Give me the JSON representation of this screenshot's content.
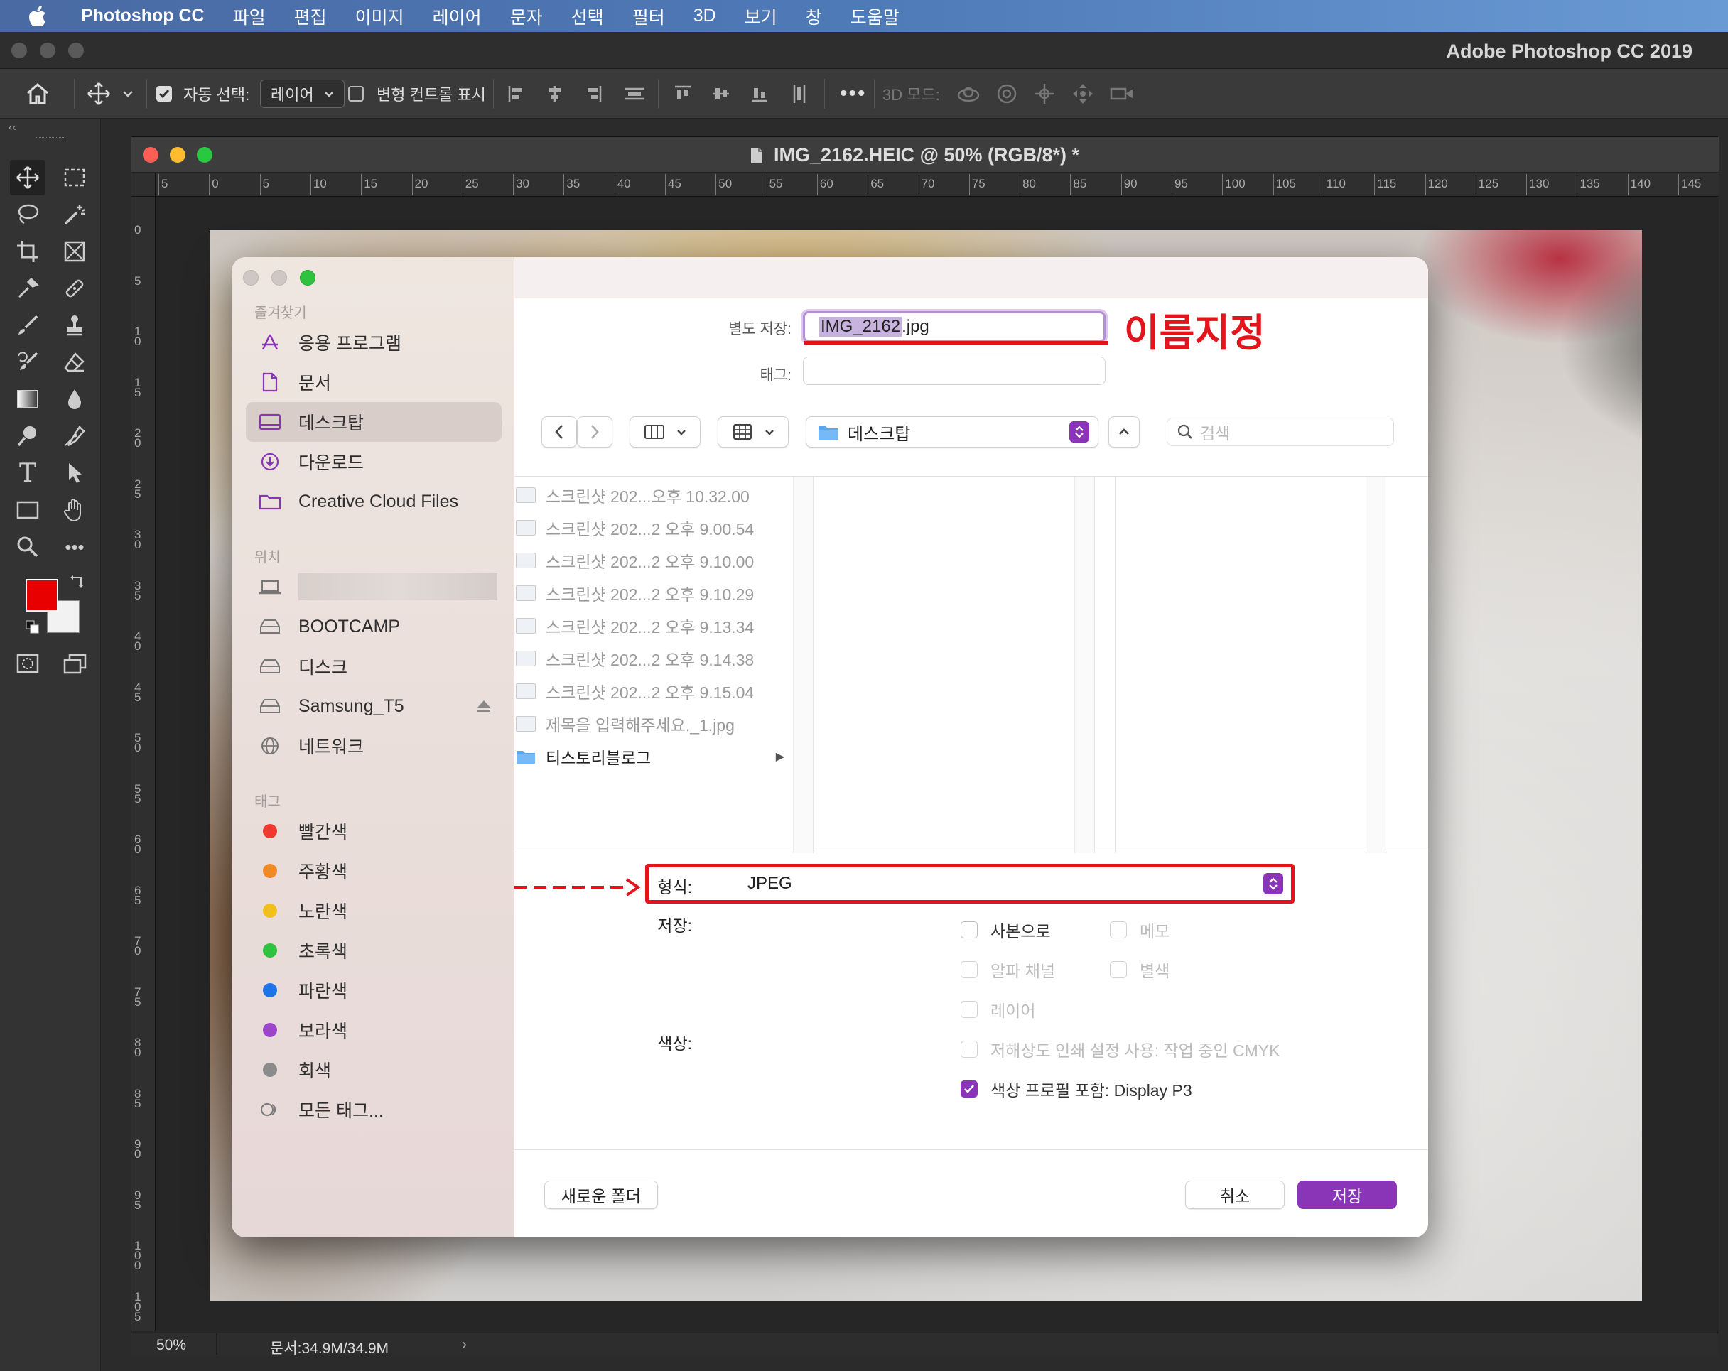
{
  "menubar": {
    "app_name": "Photoshop CC",
    "items": [
      "파일",
      "편집",
      "이미지",
      "레이어",
      "문자",
      "선택",
      "필터",
      "3D",
      "보기",
      "창",
      "도움말"
    ]
  },
  "window_title": "Adobe Photoshop CC 2019",
  "options_bar": {
    "auto_select_label": "자동 선택:",
    "auto_select_value": "레이어",
    "transform_label": "변형 컨트롤 표시",
    "mode_3d_label": "3D 모드:"
  },
  "colors": {
    "foreground": "#e80000",
    "background": "#f2f2f2",
    "accent": "#8a35b7",
    "annotation": "#e3141b"
  },
  "document": {
    "title": "IMG_2162.HEIC @ 50% (RGB/8*) *",
    "zoom": "50%",
    "doc_size": "문서:34.9M/34.9M",
    "ruler_h": [
      "5",
      "0",
      "5",
      "10",
      "15",
      "20",
      "25",
      "30",
      "35",
      "40",
      "45",
      "50",
      "55",
      "60",
      "65",
      "70",
      "75",
      "80",
      "85",
      "90",
      "95",
      "100",
      "105",
      "110",
      "115",
      "120",
      "125",
      "130",
      "135",
      "140",
      "145"
    ],
    "ruler_v": [
      "0",
      "5",
      "1 0",
      "1 5",
      "2 0",
      "2 5",
      "3 0",
      "3 5",
      "4 0",
      "4 5",
      "5 0",
      "5 5",
      "6 0",
      "6 5",
      "7 0",
      "7 5",
      "8 0",
      "8 5",
      "9 0",
      "9 5",
      "1 0 0",
      "1 0 5"
    ]
  },
  "dialog": {
    "sidebar": {
      "favorites_header": "즐겨찾기",
      "favorites": [
        {
          "label": "응용 프로그램",
          "icon": "apps-icon"
        },
        {
          "label": "문서",
          "icon": "document-icon"
        },
        {
          "label": "데스크탑",
          "icon": "desktop-icon",
          "selected": true
        },
        {
          "label": "다운로드",
          "icon": "download-icon"
        },
        {
          "label": "Creative Cloud Files",
          "icon": "folder-icon"
        }
      ],
      "locations_header": "위치",
      "locations": [
        {
          "label": "BOOTCAMP",
          "icon": "drive-icon"
        },
        {
          "label": "디스크",
          "icon": "drive-icon"
        },
        {
          "label": "Samsung_T5",
          "icon": "drive-icon"
        },
        {
          "label": "네트워크",
          "icon": "network-icon"
        }
      ],
      "tags_header": "태그",
      "tags": [
        {
          "label": "빨간색",
          "color": "#f0382f"
        },
        {
          "label": "주황색",
          "color": "#f08a25"
        },
        {
          "label": "노란색",
          "color": "#f2c01d"
        },
        {
          "label": "초록색",
          "color": "#2ec23f"
        },
        {
          "label": "파란색",
          "color": "#1e73e8"
        },
        {
          "label": "보라색",
          "color": "#9b45c9"
        },
        {
          "label": "회색",
          "color": "#8b8b8b"
        }
      ],
      "all_tags": "모든 태그..."
    },
    "save_as_label": "별도 저장:",
    "filename": "IMG_2162.jpg",
    "filename_selected": "IMG_2162",
    "filename_ext": ".jpg",
    "tags_label": "태그:",
    "annotation": "이름지정",
    "location": "데스크탑",
    "search_placeholder": "검색",
    "files": [
      {
        "name": "스크린샷 202...오후 10.32.00",
        "dir": false
      },
      {
        "name": "스크린샷 202...2 오후 9.00.54",
        "dir": false
      },
      {
        "name": "스크린샷 202...2 오후 9.10.00",
        "dir": false
      },
      {
        "name": "스크린샷 202...2 오후 9.10.29",
        "dir": false
      },
      {
        "name": "스크린샷 202...2 오후 9.13.34",
        "dir": false
      },
      {
        "name": "스크린샷 202...2 오후 9.14.38",
        "dir": false
      },
      {
        "name": "스크린샷 202...2 오후 9.15.04",
        "dir": false
      },
      {
        "name": "제목을 입력해주세요._1.jpg",
        "dir": false
      },
      {
        "name": "티스토리블로그",
        "dir": true
      }
    ],
    "format_label": "형식:",
    "format_value": "JPEG",
    "save_label": "저장:",
    "save_options": [
      {
        "label": "사본으로",
        "enabled": true,
        "checked": false
      },
      {
        "label": "메모",
        "enabled": false,
        "checked": false
      },
      {
        "label": "알파 채널",
        "enabled": false,
        "checked": false
      },
      {
        "label": "별색",
        "enabled": false,
        "checked": false
      },
      {
        "label": "레이어",
        "enabled": false,
        "checked": false
      }
    ],
    "color_label": "색상:",
    "color_options": [
      {
        "label": "저해상도 인쇄 설정 사용: 작업 중인 CMYK",
        "enabled": false,
        "checked": false
      },
      {
        "label": "색상 프로필 포함: Display P3",
        "enabled": true,
        "checked": true
      }
    ],
    "new_folder": "새로운 폴더",
    "cancel": "취소",
    "save": "저장"
  }
}
